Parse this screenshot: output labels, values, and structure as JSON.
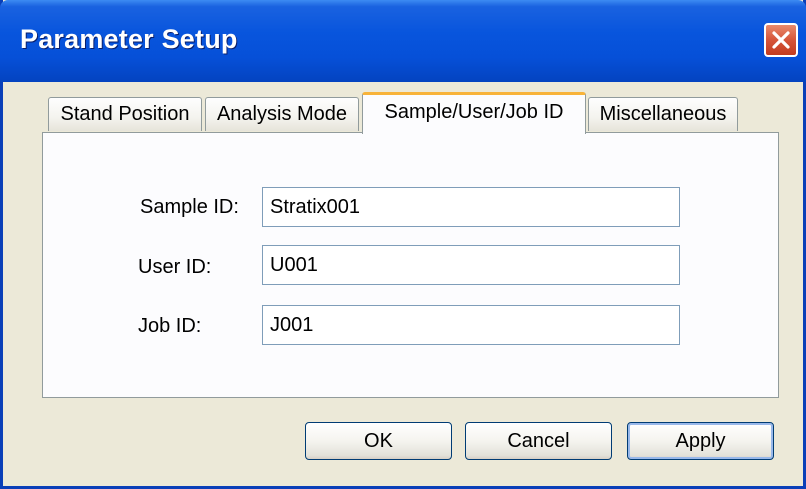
{
  "window": {
    "title": "Parameter Setup"
  },
  "icons": {
    "close": "close-icon"
  },
  "tabs": [
    {
      "label": "Stand Position",
      "active": false
    },
    {
      "label": "Analysis Mode",
      "active": false
    },
    {
      "label": "Sample/User/Job ID",
      "active": true
    },
    {
      "label": "Miscellaneous",
      "active": false
    }
  ],
  "form": {
    "sample_id": {
      "label": "Sample ID:",
      "value": "Stratix001"
    },
    "user_id": {
      "label": "User ID:",
      "value": "U001"
    },
    "job_id": {
      "label": "Job ID:",
      "value": "J001"
    }
  },
  "buttons": {
    "ok": "OK",
    "cancel": "Cancel",
    "apply": "Apply"
  },
  "colors": {
    "titlebar": "#0855dd",
    "window_bg": "#ece9d8",
    "active_tab_accent": "#f8b339",
    "close_button": "#d6553a"
  }
}
